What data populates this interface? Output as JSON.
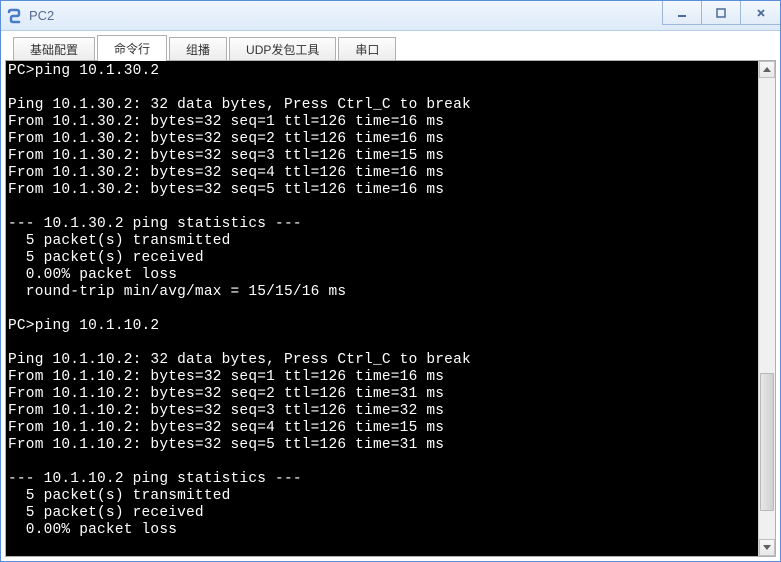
{
  "window": {
    "title": "PC2"
  },
  "tabs": [
    {
      "label": "基础配置"
    },
    {
      "label": "命令行"
    },
    {
      "label": "组播"
    },
    {
      "label": "UDP发包工具"
    },
    {
      "label": "串口"
    }
  ],
  "terminal_lines": [
    "PC>ping 10.1.30.2",
    "",
    "Ping 10.1.30.2: 32 data bytes, Press Ctrl_C to break",
    "From 10.1.30.2: bytes=32 seq=1 ttl=126 time=16 ms",
    "From 10.1.30.2: bytes=32 seq=2 ttl=126 time=16 ms",
    "From 10.1.30.2: bytes=32 seq=3 ttl=126 time=15 ms",
    "From 10.1.30.2: bytes=32 seq=4 ttl=126 time=16 ms",
    "From 10.1.30.2: bytes=32 seq=5 ttl=126 time=16 ms",
    "",
    "--- 10.1.30.2 ping statistics ---",
    "  5 packet(s) transmitted",
    "  5 packet(s) received",
    "  0.00% packet loss",
    "  round-trip min/avg/max = 15/15/16 ms",
    "",
    "PC>ping 10.1.10.2",
    "",
    "Ping 10.1.10.2: 32 data bytes, Press Ctrl_C to break",
    "From 10.1.10.2: bytes=32 seq=1 ttl=126 time=16 ms",
    "From 10.1.10.2: bytes=32 seq=2 ttl=126 time=31 ms",
    "From 10.1.10.2: bytes=32 seq=3 ttl=126 time=32 ms",
    "From 10.1.10.2: bytes=32 seq=4 ttl=126 time=15 ms",
    "From 10.1.10.2: bytes=32 seq=5 ttl=126 time=31 ms",
    "",
    "--- 10.1.10.2 ping statistics ---",
    "  5 packet(s) transmitted",
    "  5 packet(s) received",
    "  0.00% packet loss"
  ]
}
